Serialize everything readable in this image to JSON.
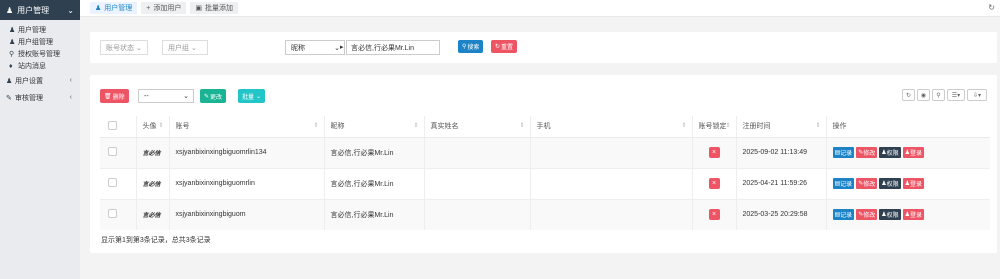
{
  "sidebar": {
    "header": "用户管理",
    "items": [
      {
        "label": "用户管理",
        "icon": "user-icon"
      },
      {
        "label": "用户组管理",
        "icon": "users-icon"
      },
      {
        "label": "授权账号管理",
        "icon": "key-icon"
      },
      {
        "label": "站内消息",
        "icon": "bell-icon"
      }
    ],
    "groups": [
      {
        "label": "用户设置",
        "icon": "user-icon"
      },
      {
        "label": "审核管理",
        "icon": "edit-icon"
      }
    ]
  },
  "tabs": [
    {
      "label": "用户管理",
      "icon": "user-icon"
    },
    {
      "label": "添加用户",
      "icon": "plus-icon"
    },
    {
      "label": "批量添加",
      "icon": "batch-icon"
    }
  ],
  "search": {
    "account_status": "账号状态",
    "user_group": "用户组",
    "field": "昵称",
    "value": "言必信,行必果Mr.Lin",
    "search_btn": "搜索",
    "reset_btn": "重置"
  },
  "toolbar": {
    "delete": "删除",
    "select_value": "--",
    "change": "更改",
    "batch": "批量"
  },
  "table": {
    "headers": [
      "头像",
      "账号",
      "昵称",
      "真实姓名",
      "手机",
      "账号锁定",
      "注册时间",
      "操作"
    ],
    "rows": [
      {
        "avatar": "言必信",
        "account": "xsjyanbixinxingbiguomrlin134",
        "nickname": "言必信,行必果Mr.Lin",
        "realname": "",
        "phone": "",
        "lock": "×",
        "time": "2025-09-02 11:13:49"
      },
      {
        "avatar": "言必信",
        "account": "xsjyanbixinxingbiguomrlin",
        "nickname": "言必信,行必果Mr.Lin",
        "realname": "",
        "phone": "",
        "lock": "×",
        "time": "2025-04-21 11:59:26"
      },
      {
        "avatar": "言必信",
        "account": "xsjyanbixinxingbiguom",
        "nickname": "言必信,行必果Mr.Lin",
        "realname": "",
        "phone": "",
        "lock": "×",
        "time": "2025-03-25 20:29:58"
      }
    ],
    "ops": [
      "记录",
      "修改",
      "权限",
      "登录"
    ]
  },
  "summary": "显示第1到第3条记录，总共3条记录",
  "colors": {
    "blue": "#1c84c6",
    "red": "#ed5565",
    "green": "#1ab394",
    "cyan": "#23c6c8",
    "dark": "#2f4050"
  }
}
